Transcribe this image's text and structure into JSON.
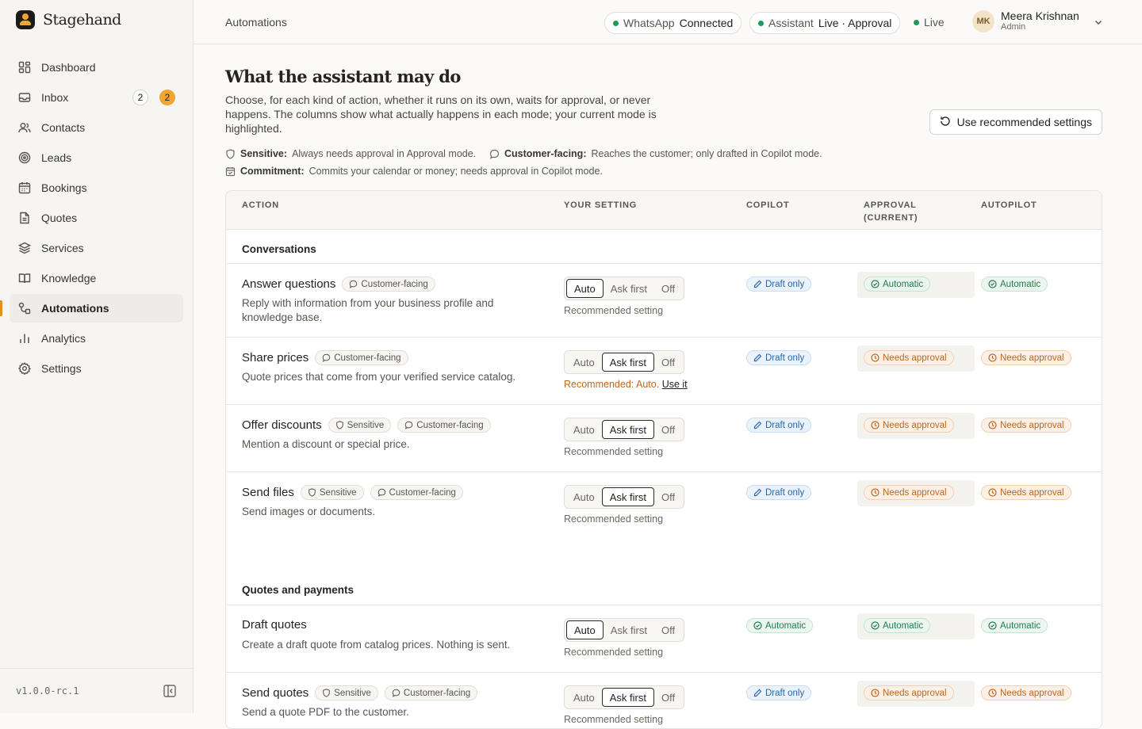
{
  "brand": {
    "name": "Stagehand"
  },
  "nav": [
    {
      "label": "Dashboard",
      "icon": "dashboard-icon"
    },
    {
      "label": "Inbox",
      "icon": "inbox-icon",
      "badge1": "2",
      "badge2": "2"
    },
    {
      "label": "Contacts",
      "icon": "contacts-icon"
    },
    {
      "label": "Leads",
      "icon": "target-icon"
    },
    {
      "label": "Bookings",
      "icon": "calendar-icon"
    },
    {
      "label": "Quotes",
      "icon": "document-icon"
    },
    {
      "label": "Services",
      "icon": "layers-icon"
    },
    {
      "label": "Knowledge",
      "icon": "book-icon"
    },
    {
      "label": "Automations",
      "icon": "automations-icon",
      "active": true
    },
    {
      "label": "Analytics",
      "icon": "chart-icon"
    },
    {
      "label": "Settings",
      "icon": "gear-icon"
    }
  ],
  "footer": {
    "version": "v1.0.0-rc.1"
  },
  "topbar": {
    "breadcrumb": "Automations",
    "whatsapp_label": "WhatsApp",
    "whatsapp_status": "Connected",
    "assistant_label": "Assistant",
    "assistant_status": "Live · Approval",
    "live_label": "Live",
    "user_initials": "MK",
    "user_name": "Meera Krishnan",
    "user_role": "Admin"
  },
  "page": {
    "title": "What the assistant may do",
    "intro": "Choose, for each kind of action, whether it runs on its own, waits for approval, or never happens. The columns show what actually happens in each mode; your current mode is highlighted.",
    "reco_button": "Use recommended settings",
    "legend": {
      "sensitive_label": "Sensitive:",
      "sensitive_text": "Always needs approval in Approval mode.",
      "customer_label": "Customer-facing:",
      "customer_text": "Reaches the customer; only drafted in Copilot mode.",
      "commitment_label": "Commitment:",
      "commitment_text": "Commits your calendar or money; needs approval in Copilot mode."
    }
  },
  "table": {
    "headers": {
      "action": "ACTION",
      "setting": "YOUR SETTING",
      "copilot": "COPILOT",
      "approval": "APPROVAL",
      "approval_sub": "(CURRENT)",
      "autopilot": "AUTOPILOT"
    },
    "options": {
      "auto": "Auto",
      "ask": "Ask first",
      "off": "Off"
    },
    "sections": {
      "conversations": "Conversations",
      "quotes": "Quotes and payments"
    },
    "rows": [
      {
        "name": "Answer questions",
        "tags": [
          "Customer-facing"
        ],
        "desc": "Reply with information from your business profile and knowledge base.",
        "setting": "auto",
        "hint": "Recommended setting",
        "copilot": "Draft only",
        "approval": "Automatic",
        "autopilot": "Automatic"
      },
      {
        "name": "Share prices",
        "tags": [
          "Customer-facing"
        ],
        "desc": "Quote prices that come from your verified service catalog.",
        "setting": "ask",
        "hint": "Recommended: Auto.",
        "hint_link": "Use it",
        "copilot": "Draft only",
        "approval": "Needs approval",
        "autopilot": "Needs approval"
      },
      {
        "name": "Offer discounts",
        "tags": [
          "Sensitive",
          "Customer-facing"
        ],
        "desc": "Mention a discount or special price.",
        "setting": "ask",
        "hint": "Recommended setting",
        "copilot": "Draft only",
        "approval": "Needs approval",
        "autopilot": "Needs approval"
      },
      {
        "name": "Send files",
        "tags": [
          "Sensitive",
          "Customer-facing"
        ],
        "desc": "Send images or documents.",
        "setting": "ask",
        "hint": "Recommended setting",
        "copilot": "Draft only",
        "approval": "Needs approval",
        "autopilot": "Needs approval"
      },
      {
        "name": "Draft quotes",
        "tags": [],
        "desc": "Create a draft quote from catalog prices. Nothing is sent.",
        "setting": "auto",
        "hint": "Recommended setting",
        "copilot": "Automatic",
        "approval": "Automatic",
        "autopilot": "Automatic"
      },
      {
        "name": "Send quotes",
        "tags": [
          "Sensitive",
          "Customer-facing"
        ],
        "desc": "Send a quote PDF to the customer.",
        "setting": "ask",
        "hint": "Recommended setting",
        "copilot": "Draft only",
        "approval": "Needs approval",
        "autopilot": "Needs approval"
      }
    ]
  },
  "colors": {
    "accent": "#f2a531",
    "live": "#1f9a5a",
    "draft": "#2b67a8",
    "automatic": "#1f7e4b",
    "needs": "#c1661b"
  }
}
